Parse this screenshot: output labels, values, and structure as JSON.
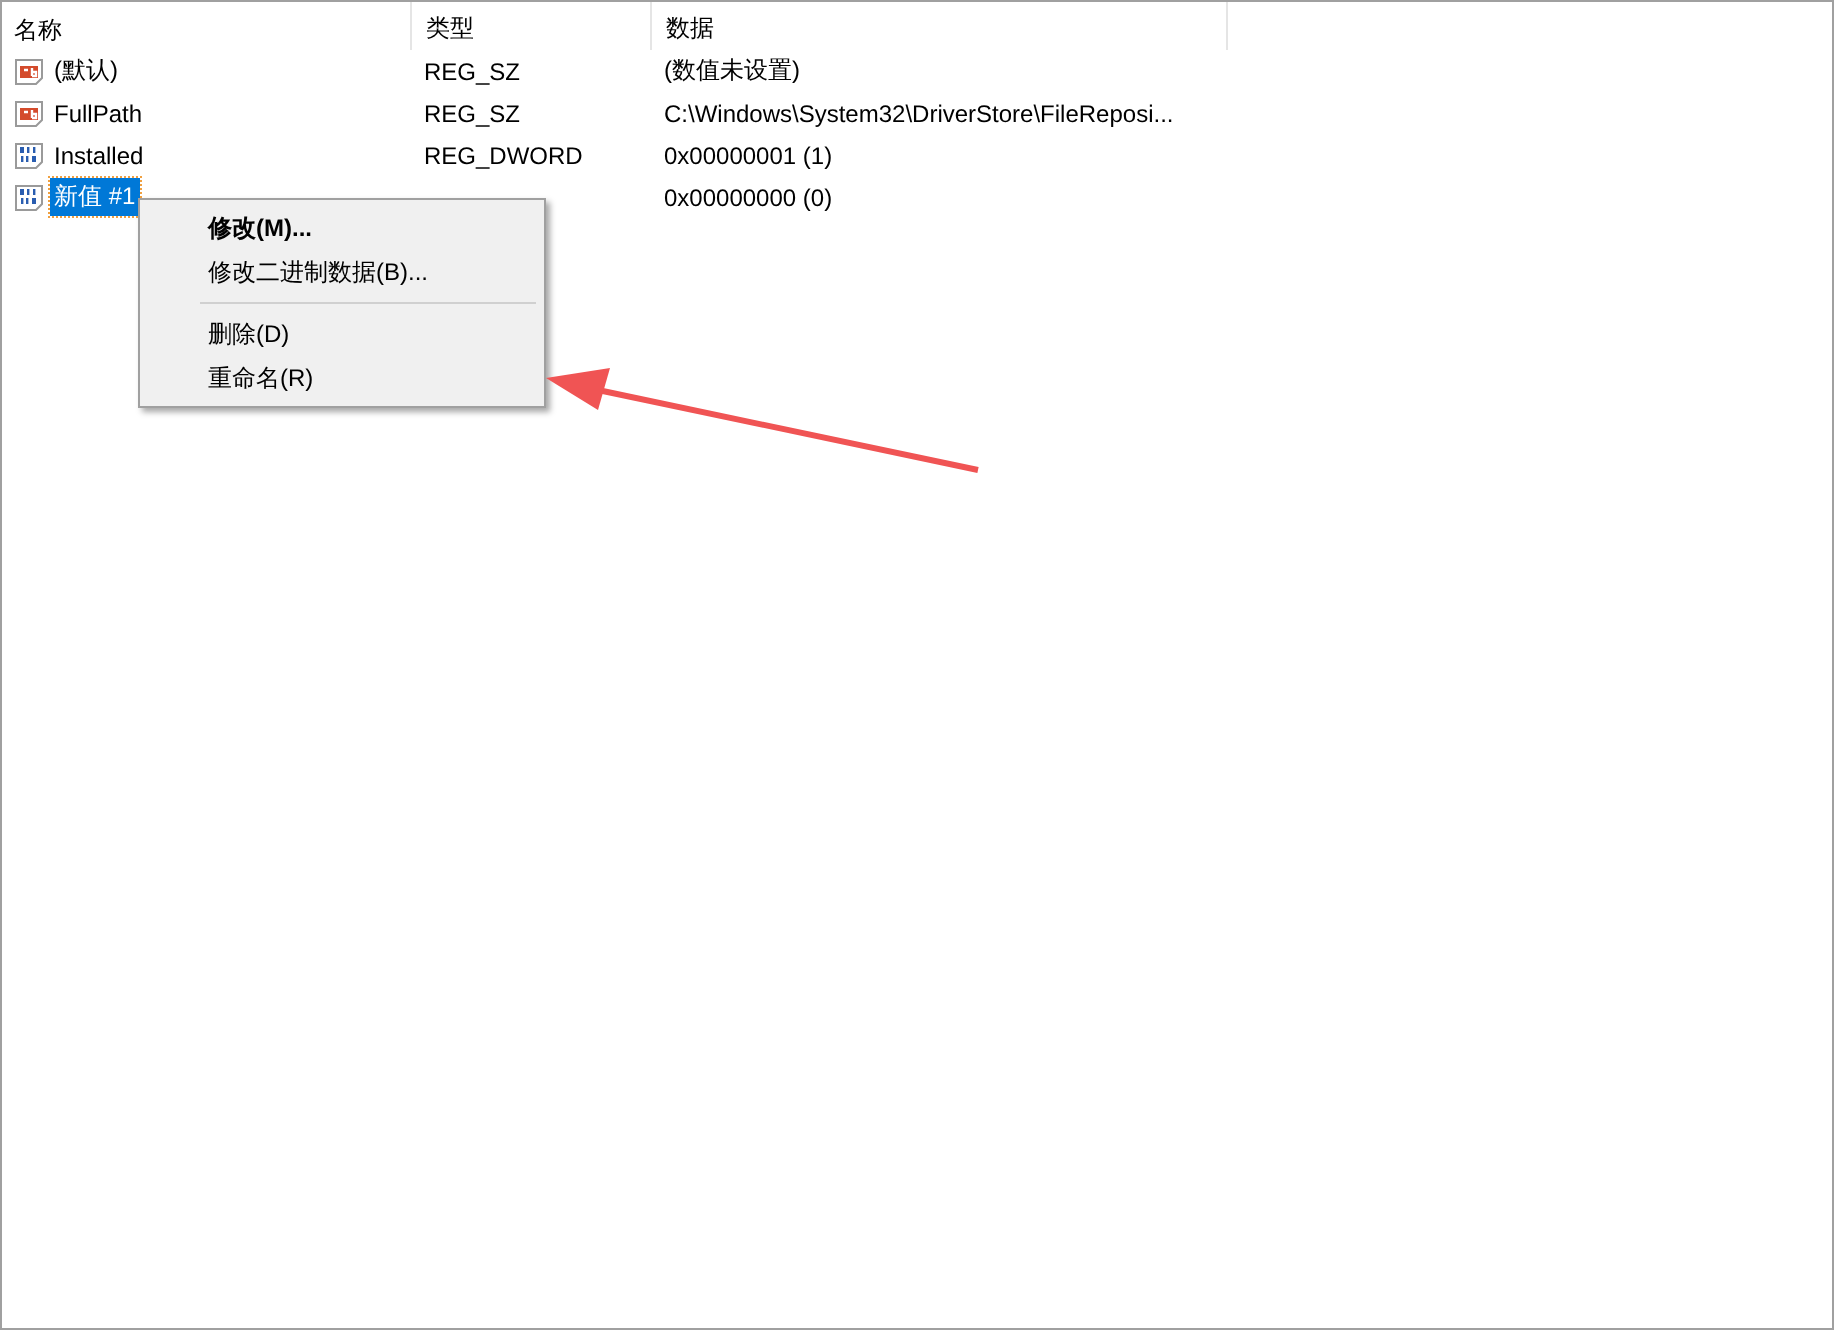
{
  "table": {
    "columns": [
      "名称",
      "类型",
      "数据"
    ],
    "rows": [
      {
        "kind": "string",
        "name": "(默认)",
        "type": "REG_SZ",
        "data": "(数值未设置)",
        "selected": false
      },
      {
        "kind": "string",
        "name": "FullPath",
        "type": "REG_SZ",
        "data": "C:\\Windows\\System32\\DriverStore\\FileReposi...",
        "selected": false
      },
      {
        "kind": "binary",
        "name": "Installed",
        "type": "REG_DWORD",
        "data": "0x00000001 (1)",
        "selected": false
      },
      {
        "kind": "binary",
        "name": "新值 #1",
        "data": "0x00000000 (0)",
        "selected": true
      }
    ]
  },
  "context_menu": {
    "items": [
      {
        "kind": "item",
        "label": "修改(M)...",
        "default": true
      },
      {
        "kind": "item",
        "label": "修改二进制数据(B)...",
        "default": false
      },
      {
        "kind": "separator"
      },
      {
        "kind": "item",
        "label": "删除(D)",
        "default": false
      },
      {
        "kind": "item",
        "label": "重命名(R)",
        "default": false
      }
    ]
  }
}
